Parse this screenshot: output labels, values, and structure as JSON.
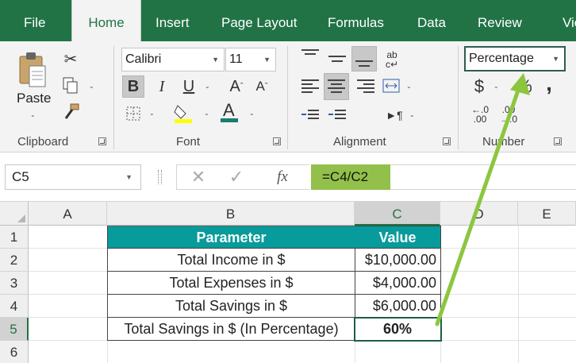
{
  "menu": {
    "tabs": [
      {
        "label": "File"
      },
      {
        "label": "Home"
      },
      {
        "label": "Insert"
      },
      {
        "label": "Page Layout"
      },
      {
        "label": "Formulas"
      },
      {
        "label": "Data"
      },
      {
        "label": "Review"
      },
      {
        "label": "View"
      }
    ],
    "active_tab": "Home"
  },
  "ribbon": {
    "clipboard": {
      "paste_label": "Paste",
      "group_label": "Clipboard"
    },
    "font": {
      "font_name": "Calibri",
      "font_size": "11",
      "bold": "B",
      "italic": "I",
      "underline": "U",
      "group_label": "Font"
    },
    "alignment": {
      "group_label": "Alignment"
    },
    "number": {
      "format": "Percentage",
      "currency_symbol": "$",
      "percent_symbol": "%",
      "comma_symbol": ",",
      "group_label": "Number"
    }
  },
  "formula_bar": {
    "name_box": "C5",
    "fx_label": "fx",
    "formula": "=C4/C2"
  },
  "sheet": {
    "columns": [
      "A",
      "B",
      "C",
      "D",
      "E"
    ],
    "selected_column": "C",
    "rows": [
      "1",
      "2",
      "3",
      "4",
      "5",
      "6"
    ],
    "selected_row": "5",
    "table": {
      "header": {
        "parameter": "Parameter",
        "value": "Value"
      },
      "rows": [
        {
          "parameter": "Total Income in $",
          "value": "$10,000.00"
        },
        {
          "parameter": "Total Expenses in $",
          "value": "$4,000.00"
        },
        {
          "parameter": "Total Savings in $",
          "value": "$6,000.00"
        },
        {
          "parameter": "Total Savings in $ (In Percentage)",
          "value": "60%"
        }
      ]
    }
  },
  "colors": {
    "excel_green": "#217346",
    "table_header": "#079b9b",
    "formula_highlight": "#92c04a",
    "arrow": "#8cc63f"
  }
}
